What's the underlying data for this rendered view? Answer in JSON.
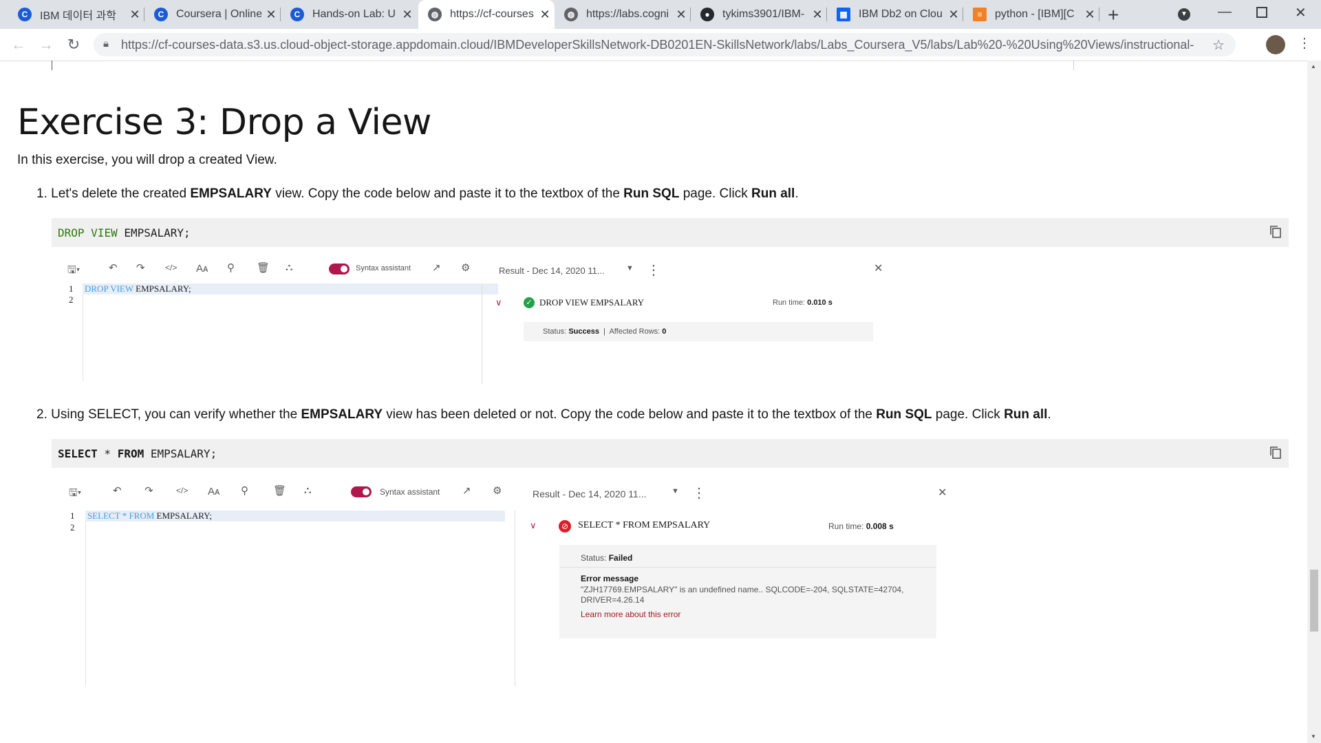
{
  "browser": {
    "tabs": [
      {
        "title": "IBM 데이터 과학",
        "icon": "coursera-icon",
        "active": false
      },
      {
        "title": "Coursera | Online",
        "icon": "coursera-icon",
        "active": false
      },
      {
        "title": "Hands-on Lab: U",
        "icon": "coursera-icon",
        "active": false
      },
      {
        "title": "https://cf-courses",
        "icon": "globe-icon",
        "active": true
      },
      {
        "title": "https://labs.cogni",
        "icon": "globe-icon",
        "active": false
      },
      {
        "title": "tykims3901/IBM-",
        "icon": "github-icon",
        "active": false
      },
      {
        "title": "IBM Db2 on Clou",
        "icon": "ibm-icon",
        "active": false
      },
      {
        "title": "python - [IBM][C",
        "icon": "stackoverflow-icon",
        "active": false
      }
    ],
    "url": "https://cf-courses-data.s3.us.cloud-object-storage.appdomain.cloud/IBMDeveloperSkillsNetwork-DB0201EN-SkillsNetwork/labs/Labs_Coursera_V5/labs/Lab%20-%20Using%20Views/instructional-labs.m..."
  },
  "content": {
    "heading": "Exercise 3: Drop a View",
    "intro": "In this exercise, you will drop a created View.",
    "step1": {
      "num": "1.",
      "a": "Let's delete the created ",
      "b": "EMPSALARY",
      "c": " view. Copy the code below and paste it to the textbox of the ",
      "d": "Run SQL",
      "e": " page. Click ",
      "f": "Run all",
      "g": "."
    },
    "code1": {
      "kw1": "DROP",
      "kw2": "VIEW",
      "rest": " EMPSALARY;"
    },
    "step2": {
      "num": "2.",
      "a": "Using SELECT, you can verify whether the ",
      "b": "EMPSALARY",
      "c": " view has been deleted or not. Copy the code below and paste it to the textbox of the ",
      "d": "Run SQL",
      "e": " page. Click ",
      "f": "Run all",
      "g": "."
    },
    "code2": {
      "kw1": "SELECT",
      "star": " * ",
      "kw2": "FROM",
      "rest": " EMPSALARY;"
    }
  },
  "shot1": {
    "syntax_label": "Syntax assistant",
    "editor_lines": [
      {
        "n": "1",
        "kw": "DROP VIEW",
        "rest": " EMPSALARY;"
      },
      {
        "n": "2"
      }
    ],
    "result_label": "Result - Dec 14, 2020 11...",
    "query": "DROP VIEW EMPSALARY",
    "runtime_label": "Run time:",
    "runtime": "0.010 s",
    "status_label": "Status:",
    "status": "Success",
    "affected_label": "Affected Rows:",
    "affected": "0"
  },
  "shot2": {
    "syntax_label": "Syntax assistant",
    "editor_lines": [
      {
        "n": "1",
        "kw1": "SELECT",
        "star": " * ",
        "kw2": "FROM",
        "rest": " EMPSALARY;"
      },
      {
        "n": "2"
      }
    ],
    "result_label": "Result - Dec 14, 2020 11...",
    "query": "SELECT * FROM EMPSALARY",
    "runtime_label": "Run time:",
    "runtime": "0.008 s",
    "status_label": "Status:",
    "status": "Failed",
    "error_title": "Error message",
    "error_line1": "\"ZJH17769.EMPSALARY\" is an undefined name.. SQLCODE=-204, SQLSTATE=42704,",
    "error_line2": "DRIVER=4.26.14",
    "learn_more": "Learn more about this error"
  },
  "colors": {
    "success": "#24a148",
    "failed": "#da1e28",
    "toggle": "#b0174d",
    "link": "#a2191f",
    "sql_keyword": "#3f9de0"
  }
}
